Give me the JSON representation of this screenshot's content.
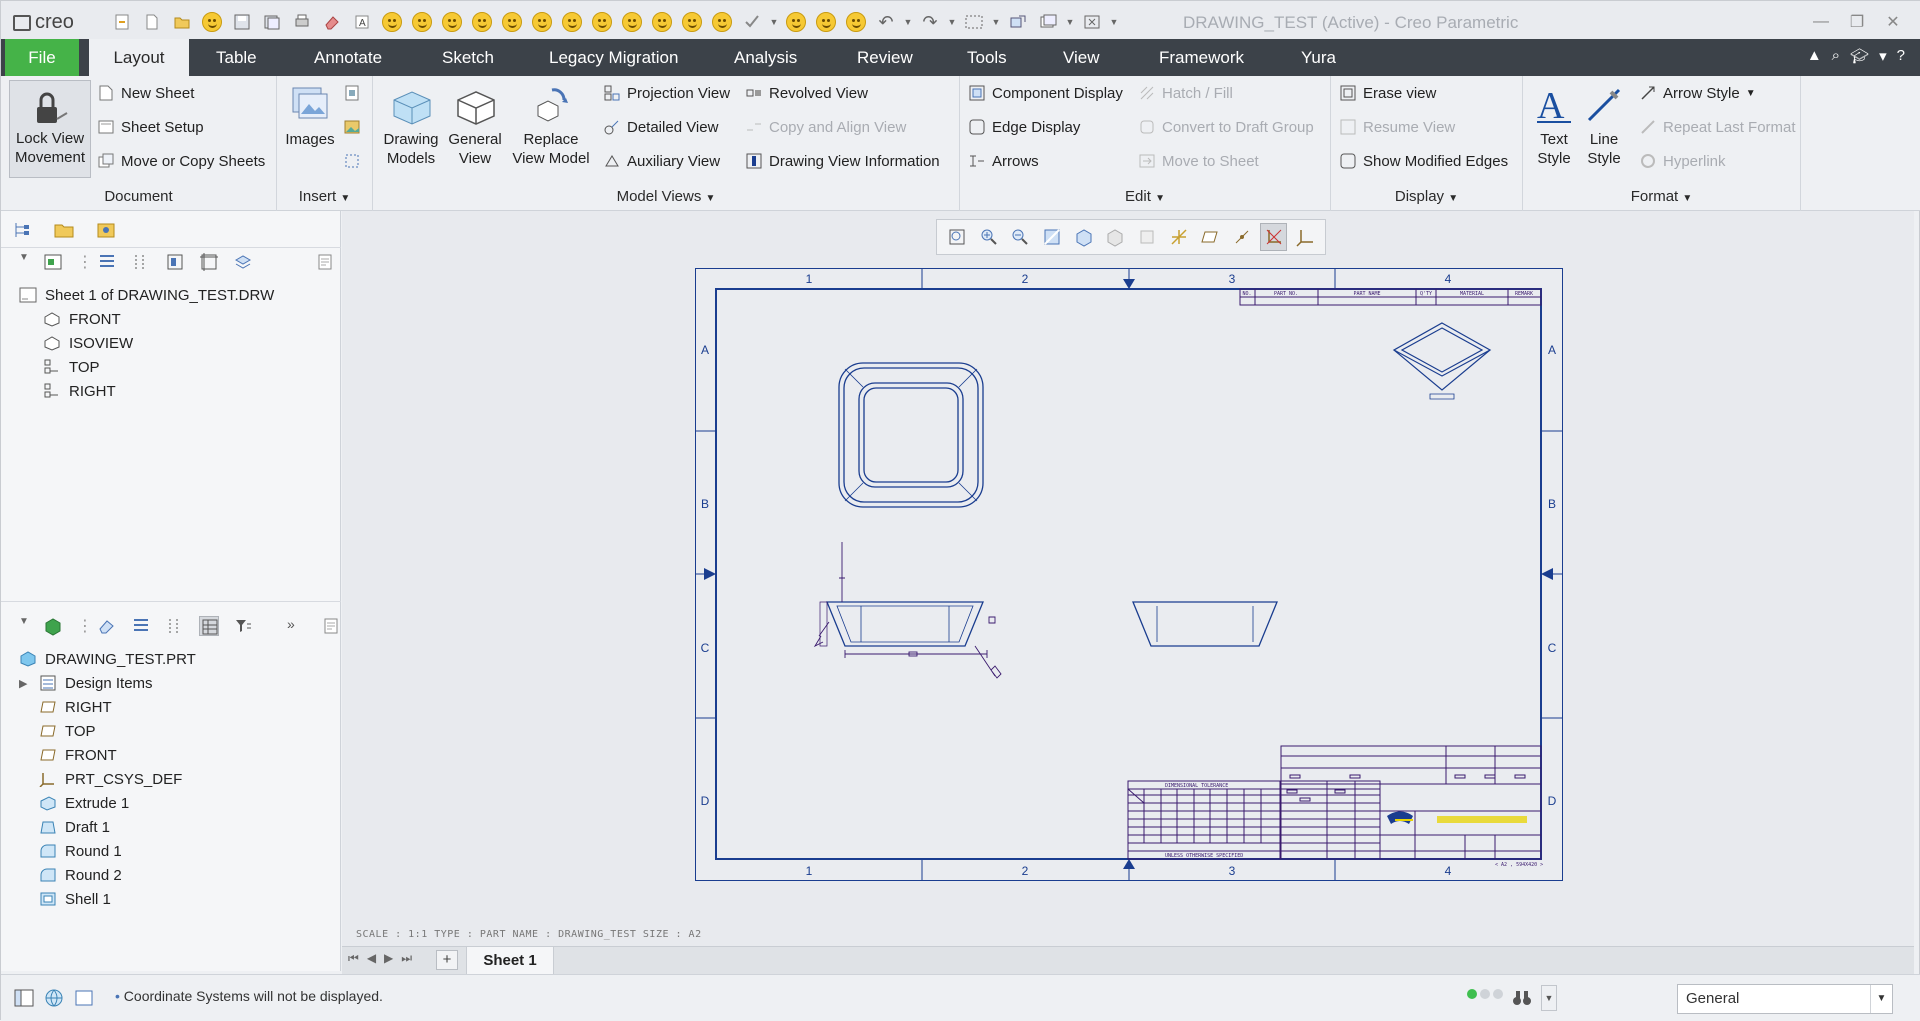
{
  "app": {
    "logo_text": "creo",
    "window_title": "DRAWING_TEST (Active) - Creo Parametric"
  },
  "window_controls": [
    "minimize",
    "restore",
    "close"
  ],
  "menubar": {
    "tabs": [
      "File",
      "Layout",
      "Table",
      "Annotate",
      "Sketch",
      "Legacy Migration",
      "Analysis",
      "Review",
      "Tools",
      "View",
      "Framework",
      "Yura"
    ],
    "active": "Layout"
  },
  "ribbon": {
    "document": {
      "label": "Document",
      "lock": "Lock View\nMovement",
      "new_sheet": "New Sheet",
      "sheet_setup": "Sheet Setup",
      "move_copy": "Move or Copy Sheets"
    },
    "insert": {
      "label": "Insert",
      "images": "Images"
    },
    "model_views": {
      "label": "Model Views",
      "drawing_models": "Drawing\nModels",
      "general_view": "General\nView",
      "replace_view_model": "Replace\nView Model",
      "projection_view": "Projection View",
      "detailed_view": "Detailed View",
      "auxiliary_view": "Auxiliary View",
      "revolved_view": "Revolved View",
      "copy_align_view": "Copy and Align View",
      "drawing_view_info": "Drawing View Information"
    },
    "edit": {
      "label": "Edit",
      "component_display": "Component Display",
      "edge_display": "Edge Display",
      "arrows": "Arrows",
      "hatch_fill": "Hatch / Fill",
      "convert_draft_group": "Convert to Draft Group",
      "move_to_sheet": "Move to Sheet"
    },
    "display": {
      "label": "Display",
      "erase_view": "Erase view",
      "resume_view": "Resume View",
      "show_modified_edges": "Show Modified Edges"
    },
    "format": {
      "label": "Format",
      "text_style": "Text\nStyle",
      "line_style": "Line\nStyle",
      "arrow_style": "Arrow Style",
      "repeat_last_format": "Repeat Last Format",
      "hyperlink": "Hyperlink"
    }
  },
  "drawing_tree": {
    "root": "Sheet 1 of DRAWING_TEST.DRW",
    "items": [
      "FRONT",
      "ISOVIEW",
      "TOP",
      "RIGHT"
    ]
  },
  "model_tree": {
    "root": "DRAWING_TEST.PRT",
    "items": [
      "Design Items",
      "RIGHT",
      "TOP",
      "FRONT",
      "PRT_CSYS_DEF",
      "Extrude 1",
      "Draft 1",
      "Round 1",
      "Round 2",
      "Shell 1"
    ]
  },
  "sheet": {
    "columns": [
      "1",
      "2",
      "3",
      "4"
    ],
    "rows": [
      "A",
      "B",
      "C",
      "D"
    ],
    "bom_header": [
      "NO.",
      "PART NO.",
      "PART NAME",
      "Q'TY",
      "MATERIAL",
      "REMARK"
    ],
    "scale_line": "SCALE : 1:1    TYPE : PART  NAME : DRAWING_TEST  SIZE : A2",
    "tolerance_title": "DIMENSIONAL  TOLERANCE",
    "unless_text": "UNLESS  OTHERWISE  SPECIFIED",
    "sheet_size_label": "< A2 , 594X420 >"
  },
  "sheet_tabs": {
    "active": "Sheet 1"
  },
  "status": {
    "message": "Coordinate Systems will not be displayed.",
    "filter_value": "General"
  },
  "colors": {
    "menubar": "#3c4249",
    "file_tab": "#45b348",
    "drawing_line": "#1a3d8f",
    "table_line": "#3a1a6e",
    "title_yellow": "#e8d400"
  }
}
